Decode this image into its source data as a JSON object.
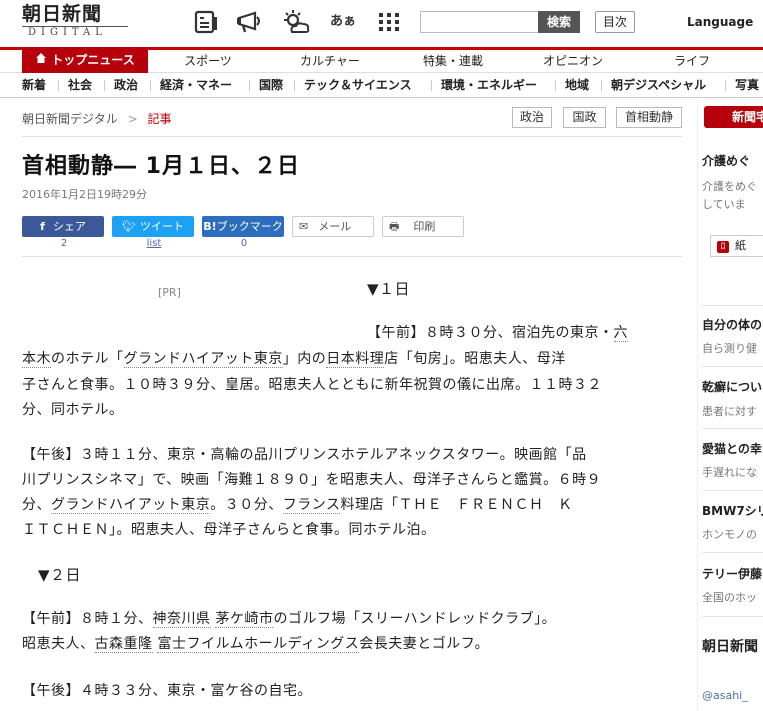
{
  "header": {
    "logo_main": "朝日新聞",
    "logo_sub": "DIGITAL",
    "icons": [
      "newspaper-icon",
      "megaphone-icon",
      "weather-icon",
      "font-size-icon",
      "grid-menu-icon"
    ],
    "font_icon_text": "あぁ",
    "search_placeholder": "",
    "search_button": "検索",
    "index_button": "目次",
    "language": "Language"
  },
  "main_nav": [
    "トップニュース",
    "スポーツ",
    "カルチャー",
    "特集・連載",
    "オピニオン",
    "ライフ"
  ],
  "sub_nav": [
    "新着",
    "社会",
    "政治",
    "経済・マネー",
    "国際",
    "テック＆サイエンス",
    "環境・エネルギー",
    "地域",
    "朝デジスペシャル",
    "写真"
  ],
  "breadcrumb": {
    "home": "朝日新聞デジタル",
    "sep": ">",
    "current": "記事"
  },
  "tags": [
    "政治",
    "国政",
    "首相動静"
  ],
  "article": {
    "title": "首相動静― 1月１日、２日",
    "date": "2016年1月2日19時29分",
    "share": {
      "facebook": "シェア",
      "twitter": "ツイート",
      "hatena": "ブックマーク",
      "mail": "メール",
      "print": "印刷",
      "facebook_count": "2",
      "twitter_count": "list",
      "hatena_count": "0"
    },
    "pr": "[PR]",
    "heading1": "▼１日",
    "heading2": "▼２日",
    "p1_lead": "【午前】８時３０分、宿泊先の東京・",
    "p1_link1": "六",
    "p1_line2_link": "本木",
    "p1_line2_a": "のホテル「",
    "p1_line2_link2": "グランドハイアット東京",
    "p1_line2_b": "」内の",
    "p1_line2_link3": "日本料理",
    "p1_line2_c": "店「旬房」。昭恵夫人、母洋",
    "p1_line3": "子さんと食事。１０時３９分、皇居。昭恵夫人とともに新年祝賀の儀に出席。１１時３２",
    "p1_line4": "分、同ホテル。",
    "p2_line1": "【午後】３時１１分、東京・高輪の品川プリンスホテルアネックスタワー。映画館「品",
    "p2_line2": "川プリンスシネマ」で、映画「海難１８９０」を昭恵夫人、母洋子さんらと鑑賞。６時９",
    "p2_line3_a": "分、",
    "p2_line3_link1": "グランドハイアット東京",
    "p2_line3_b": "。３０分、",
    "p2_line3_link2": "フランス",
    "p2_line3_c": "料理店「ＴＨＥ　ＦＲＥＮＣＨ　Ｋ",
    "p2_line4": "ＩＴＣＨＥＮ」。昭恵夫人、母洋子さんらと食事。同ホテル泊。",
    "p3_line1_a": "【午前】８時１分、",
    "p3_line1_link1": "神奈川県",
    "p3_line1_link2": "茅ケ崎市",
    "p3_line1_b": "のゴルフ場「スリーハンドレッドクラブ」。",
    "p3_line2_a": "昭恵夫人、",
    "p3_line2_link1": "古森重隆",
    "p3_line2_link2": "富士フイルムホールディングス",
    "p3_line2_b": "会長夫妻とゴルフ。",
    "p4_line1": "【午後】４時３３分、東京・富ケ谷の自宅。"
  },
  "rail": {
    "button": "新聞宅",
    "items": [
      {
        "title": "介護めぐ",
        "sub1": "介護をめぐ",
        "sub2": "していま"
      },
      {
        "title": "紙",
        "sub1": "",
        "sub2": ""
      },
      {
        "title": "自分の体の",
        "sub1": "自ら測り健",
        "sub2": ""
      },
      {
        "title": "乾癬につい",
        "sub1": "患者に対す",
        "sub2": ""
      },
      {
        "title": "愛猫との幸",
        "sub1": "手遅れにな",
        "sub2": ""
      },
      {
        "title": "BMW7シリ",
        "sub1": "ホンモノの",
        "sub2": ""
      },
      {
        "title": "テリー伊藤",
        "sub1": "全国のホッ",
        "sub2": ""
      },
      {
        "title": "朝日新聞",
        "sub1": "",
        "sub2": ""
      },
      {
        "title": "@asahi_",
        "sub1": "",
        "sub2": ""
      }
    ]
  },
  "colors": {
    "brand_red": "#b6000b",
    "facebook": "#3b5998",
    "twitter": "#1da1f2",
    "hatena": "#2c6ebd",
    "link_gray": "#888"
  }
}
